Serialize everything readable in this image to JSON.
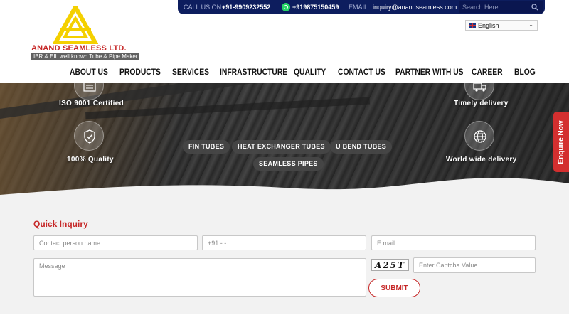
{
  "brand": {
    "name": "ANAND SEAMLESS LTD.",
    "tagline": "IBR & EIL well known Tube & Pipe Maker"
  },
  "topbar": {
    "call_label": "CALL US ON:",
    "phone": "+91-9909232552",
    "whatsapp": "+919875150459",
    "email_label": "EMAIL:",
    "email": "inquiry@anandseamless.com",
    "search_placeholder": "Search Here"
  },
  "language": {
    "selected": "English"
  },
  "nav": {
    "items": [
      "ABOUT US",
      "PRODUCTS",
      "SERVICES",
      "INFRASTRUCTURE",
      "QUALITY",
      "CONTACT US",
      "PARTNER WITH US",
      "CAREER",
      "BLOG"
    ]
  },
  "hero": {
    "features": {
      "iso": "ISO 9001 Certified",
      "delivery": "Timely delivery",
      "quality": "100% Quality",
      "worldwide": "World wide delivery"
    },
    "pills": [
      "FIN TUBES",
      "HEAT EXCHANGER TUBES",
      "U BEND TUBES",
      "SEAMLESS PIPES"
    ]
  },
  "enquire": {
    "label": "Enquire Now"
  },
  "form": {
    "title": "Quick Inquiry",
    "name_placeholder": "Contact person name",
    "phone_placeholder": "+91 - -",
    "email_placeholder": "E mail",
    "message_placeholder": "Message",
    "captcha_text": "A25T",
    "captcha_placeholder": "Enter Captcha Value",
    "submit_label": "SUBMIT"
  },
  "colors": {
    "topbar": "#0d1d5e",
    "accent": "#c62828",
    "logo_yellow": "#f4d000"
  }
}
